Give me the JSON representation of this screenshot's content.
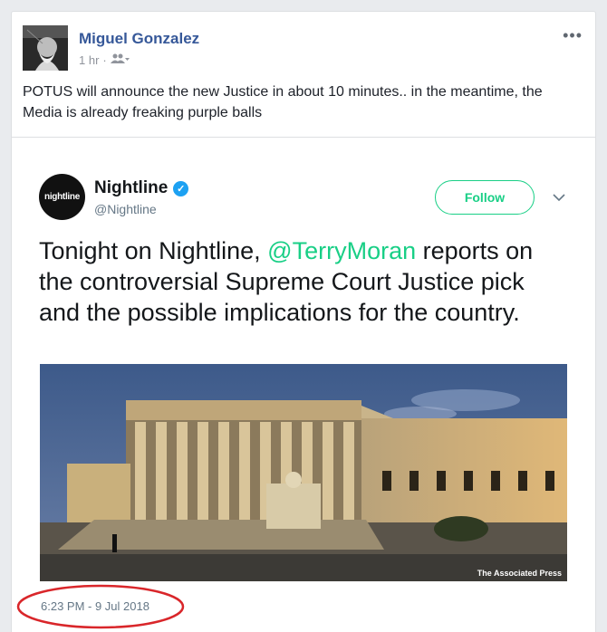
{
  "post": {
    "author": "Miguel Gonzalez",
    "time": "1 hr",
    "separator": "·",
    "audience_icon": "friends-icon",
    "menu_label": "•••",
    "text": "POTUS will announce the new Justice in about 10 minutes.. in the meantime, the Media is already freaking purple balls"
  },
  "tweet": {
    "avatar_text": "nightline",
    "name": "Nightline",
    "handle": "@Nightline",
    "follow_label": "Follow",
    "text_before": "Tonight on Nightline, ",
    "mention": "@TerryMoran",
    "text_after": " reports on the controversial Supreme Court Justice pick and the possible implications for the country.",
    "photo_credit": "The Associated Press",
    "timestamp": "6:23 PM - 9 Jul 2018"
  },
  "colors": {
    "link_blue": "#365899",
    "twitter_green": "#19cf86",
    "verified_blue": "#1da1f2",
    "annotation_red": "#d9262a"
  }
}
